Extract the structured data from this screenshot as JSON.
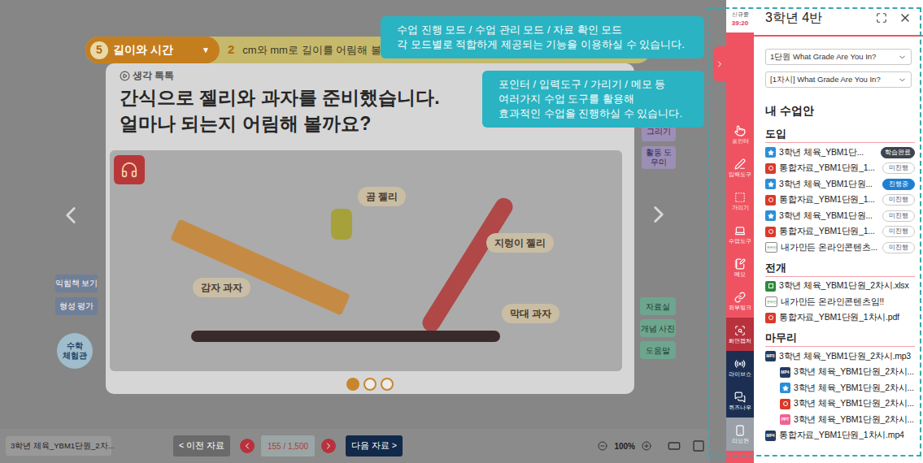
{
  "tooltips": [
    {
      "lines": [
        "수업 진행 모드 / 수업 관리 모드 / 자료 확인 모드",
        "각 모드별로 적합하게 제공되는 기능을 이용하실 수 있습니다."
      ]
    },
    {
      "lines": [
        "포인터 / 입력도구 / 가리기 / 메모 등",
        "여러가지 수업 도구를 활용해",
        "효과적인 수업을 진행하실 수 있습니다."
      ]
    }
  ],
  "lesson_header": {
    "unit_number": "5",
    "unit_title": "길이와 시간",
    "dropdown": "▼",
    "lesson_number": "2",
    "lesson_title": "cm와 mm로 길이를 어림해 볼까요"
  },
  "card": {
    "tag": "생각 톡톡",
    "question_lines": [
      "간식으로 젤리와 과자를 준비했습니다.",
      "얼마나 되는지 어림해 볼까요?"
    ],
    "image_labels": [
      "곰 젤리",
      "지렁이 젤리",
      "감자 과자",
      "막대 과자"
    ],
    "pages": [
      {
        "selected": true
      },
      {
        "selected": false
      },
      {
        "selected": false
      }
    ]
  },
  "left_buttons": [
    "익힘책 보기",
    "형성 평가"
  ],
  "math_lab": [
    "수학",
    "체험관"
  ],
  "right_top_buttons": [
    "그리기",
    "활동 도우미"
  ],
  "right_buttons": [
    "자료실",
    "개념 사진",
    "도움말"
  ],
  "bottom_bar": {
    "current_file": "3학년 체육_YBM1단원_2차...",
    "prev": "< 이전 자료",
    "page": "155 / 1,500",
    "next": "다음 자료 >",
    "zoom": "100%"
  },
  "panel": {
    "status": "신규중",
    "timer": "39:20",
    "title": "3학년 4반",
    "unit_select": "1단원 What Grade Are You In?",
    "lesson_select": "[1차시] What Grade Are You In?",
    "heading": "내 수업안",
    "sections": [
      {
        "title": "도입",
        "items": [
          {
            "kind": "star",
            "name": "3학년 체육_YBM1단...",
            "badge": {
              "label": "학습완료",
              "kind": "done"
            },
            "children": []
          },
          {
            "kind": "pdf",
            "name": "통합자료_YBM1단원_1...",
            "badge": {
              "label": "미진행",
              "kind": "none"
            },
            "children": []
          },
          {
            "kind": "star",
            "name": "3학년 체육_YBM1단원...",
            "badge": {
              "label": "진행중",
              "kind": "progress"
            },
            "children": []
          },
          {
            "kind": "pdf",
            "name": "통합자료_YBM1단원_1...",
            "badge": {
              "label": "미진행",
              "kind": "none"
            },
            "children": []
          },
          {
            "kind": "star",
            "name": "3학년 체육_YBM1단원...",
            "badge": {
              "label": "미진행",
              "kind": "none"
            },
            "children": []
          },
          {
            "kind": "pdf",
            "name": "통합자료_YBM1단원_1...",
            "badge": {
              "label": "미진행",
              "kind": "none"
            },
            "children": []
          },
          {
            "kind": "online",
            "icon_label": "온라인",
            "name": "내가만든 온라인콘텐츠...",
            "badge": {
              "label": "미진행",
              "kind": "none"
            },
            "children": []
          }
        ]
      },
      {
        "title": "전개",
        "items": [
          {
            "kind": "xlsx",
            "name": "3학년 체육_YBM1단원_2차시.xlsx",
            "children": []
          },
          {
            "kind": "online",
            "icon_label": "온라인",
            "name": "내가만든 온라인콘텐츠임!!",
            "children": []
          },
          {
            "kind": "pdf",
            "name": "통합자료_YBM1단원_1차시.pdf",
            "children": []
          }
        ]
      },
      {
        "title": "마무리",
        "items": [
          {
            "kind": "mp3",
            "icon_label": "MP3",
            "name": "3학년 체육_YBM1단원_2차시.mp3",
            "children": [
              {
                "kind": "mp4",
                "icon_label": "MP4",
                "name": "3학년 체육_YBM1단원_2차시..."
              },
              {
                "kind": "star",
                "name": "3학년 체육_YBM1단원_2차시..."
              },
              {
                "kind": "pdf",
                "name": "3학년 체육_YBM1단원_2차시..."
              },
              {
                "kind": "ppt",
                "icon_label": "PPT",
                "name": "3학년 체육_YBM1단원_2차시..."
              }
            ]
          },
          {
            "kind": "mp4",
            "icon_label": "MP4",
            "name": "통합자료_YBM1단원_1차시.mp4",
            "children": []
          }
        ]
      }
    ]
  },
  "tools": [
    {
      "label": "포인터",
      "color": "#ef5361"
    },
    {
      "label": "입력도구",
      "color": "#ef5361"
    },
    {
      "label": "가리기",
      "color": "#ef5361"
    },
    {
      "label": "수업도구",
      "color": "#ef5361"
    },
    {
      "label": "메모",
      "color": "#ef5361"
    },
    {
      "label": "외부링크",
      "color": "#ef5361"
    },
    {
      "label": "화면캡처",
      "color": "#b8323d"
    },
    {
      "label": "라이브쇼",
      "color": "#1c2f52"
    },
    {
      "label": "퀴즈나우",
      "color": "#1c2f52"
    },
    {
      "label": "리모컨",
      "color": "#9aa0a8"
    }
  ]
}
